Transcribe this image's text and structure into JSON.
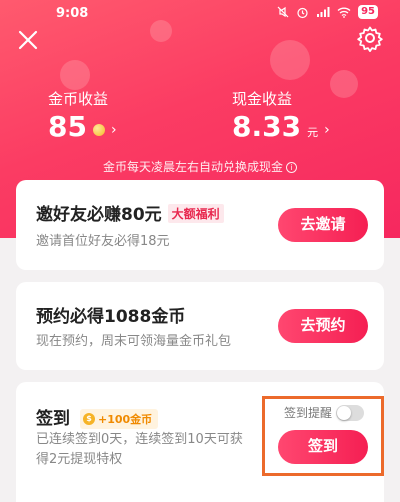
{
  "status_bar": {
    "time": "9:08",
    "battery": "95"
  },
  "header": {
    "coin_income": {
      "label": "金币收益",
      "value": "85",
      "chevron": "›"
    },
    "cash_income": {
      "label": "现金收益",
      "value": "8.33",
      "unit": "元",
      "chevron": "›"
    },
    "exchange_note": "金币每天凌晨左右自动兑换成现金",
    "info_glyph": "i"
  },
  "cards": {
    "invite": {
      "title": "邀好友必赚80元",
      "tag": "大额福利",
      "desc": "邀请首位好友必得18元",
      "button": "去邀请"
    },
    "reserve": {
      "title": "预约必得1088金币",
      "desc": "现在预约，周末可领海量金币礼包",
      "button": "去预约"
    },
    "checkin": {
      "title": "签到",
      "coin_symbol": "$",
      "coin_badge": "+100金币",
      "desc_line1": "已连续签到0天，连续签到10天可获",
      "desc_line2": "得2元提现特权",
      "reminder_label": "签到提醒",
      "reminder_on": false,
      "button": "签到"
    }
  },
  "colors": {
    "accent": "#f6285f",
    "highlight": "#ec6a2b"
  },
  "icons": [
    "close-icon",
    "gear-icon",
    "coin-icon",
    "info-icon",
    "chevron-right-icon"
  ]
}
